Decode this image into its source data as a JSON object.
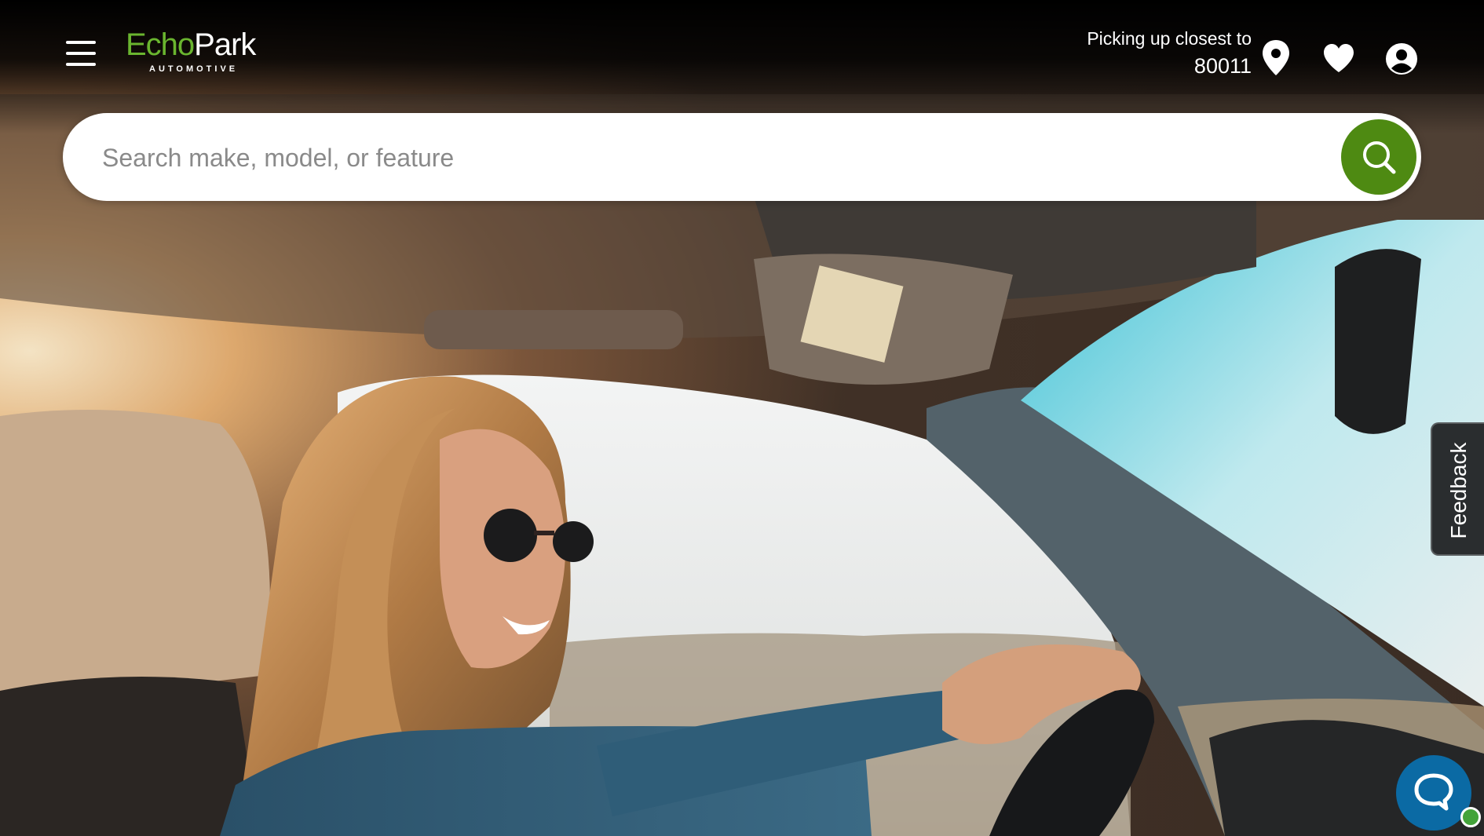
{
  "brand": {
    "name_part1": "Echo",
    "name_part2": "Park",
    "subtitle": "AUTOMOTIVE",
    "accent_color": "#6ab52f",
    "search_button_color": "#4e8a12"
  },
  "header": {
    "menu_icon": "hamburger-menu-icon",
    "location_label": "Picking up closest to",
    "location_zip": "80011",
    "icons": [
      "location-pin-icon",
      "heart-icon",
      "account-icon"
    ]
  },
  "search": {
    "placeholder": "Search make, model, or feature",
    "value": "",
    "button_icon": "search-icon"
  },
  "hero": {
    "image_subject": "woman-driving-car"
  },
  "feedback": {
    "label": "Feedback"
  },
  "chat": {
    "icon": "chat-bubble-icon",
    "status_color": "#43a33a"
  }
}
